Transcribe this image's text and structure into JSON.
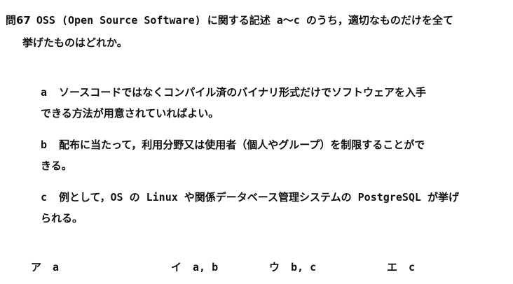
{
  "question": {
    "number": "問67",
    "stem_line1": "OSS (Open Source Software) に関する記述 a～c のうち，適切なものだけを全て",
    "stem_line2": "挙げたものはどれか。"
  },
  "statements": [
    {
      "letter": "a",
      "line1": "ソースコードではなくコンパイル済のバイナリ形式だけでソフトウェアを入手",
      "line2": "できる方法が用意されていればよい。"
    },
    {
      "letter": "b",
      "line1": "配布に当たって，利用分野又は使用者（個人やグループ）を制限することがで",
      "line2": "きる。"
    },
    {
      "letter": "c",
      "line1": "例として，OS の Linux や関係データベース管理システムの PostgreSQL が挙げ",
      "line2": "られる。"
    }
  ],
  "choices": [
    {
      "label": "ア",
      "value": "a"
    },
    {
      "label": "イ",
      "value": "a, b"
    },
    {
      "label": "ウ",
      "value": "b, c"
    },
    {
      "label": "エ",
      "value": "c"
    }
  ]
}
